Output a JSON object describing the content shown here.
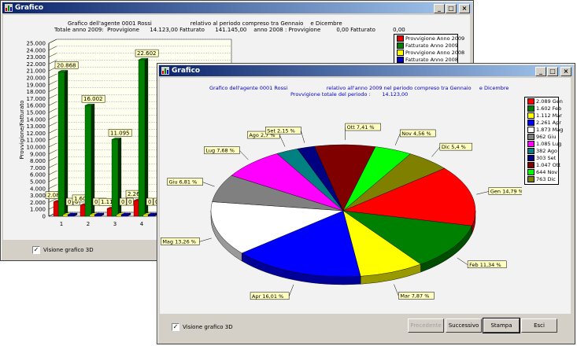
{
  "back": {
    "title": "Grafico",
    "header_line1": "Grafico dell'agente 0001 Rossi                      relativo al periodo compreso tra Gennaio    e Dicembre",
    "header_line2": "Totale anno 2009:  Provvigione      14.123,00 Fatturato      141.145,00    anno 2008 : Provvigione         0,00 Fatturato          0,00",
    "ylabel": "Provvigione/Fatturato",
    "legend": [
      {
        "label": "Provvigione Anno 2009",
        "color": "#e00000"
      },
      {
        "label": "Fatturato Anno 2009",
        "color": "#008000"
      },
      {
        "label": "Provvigione Anno 2008",
        "color": "#ffff00"
      },
      {
        "label": "Fatturato Anno 2008",
        "color": "#0000c0"
      }
    ],
    "checkbox_label": "Visione grafico 3D",
    "checkbox_mark": "✓"
  },
  "front": {
    "title": "Grafico",
    "header_line1": "Grafico dell'agente 0001 Rossi                        relativo all'anno 2009 nel periodo compreso tra Gennaio     e Dicembre",
    "header_line2": "Provvigione totale del periodo :       14.123,00",
    "legend": [
      {
        "label": "2.089 Gen",
        "color": "#ff0000"
      },
      {
        "label": "1.602 Feb",
        "color": "#008000"
      },
      {
        "label": "1.112 Mar",
        "color": "#ffff00"
      },
      {
        "label": "2.261 Apr",
        "color": "#0000ff"
      },
      {
        "label": "1.873 Mag",
        "color": "#ffffff"
      },
      {
        "label": "962 Giu",
        "color": "#808080"
      },
      {
        "label": "1.085 Lug",
        "color": "#ff00ff"
      },
      {
        "label": "382 Ago",
        "color": "#008080"
      },
      {
        "label": "303 Set",
        "color": "#000080"
      },
      {
        "label": "1.047 Ott",
        "color": "#800000"
      },
      {
        "label": "644 Nov",
        "color": "#00ff00"
      },
      {
        "label": "763 Dic",
        "color": "#808000"
      }
    ],
    "checkbox_label": "Visione grafico 3D",
    "checkbox_mark": "✓",
    "buttons": {
      "prev": "Precedente",
      "next": "Successivo",
      "print": "Stampa",
      "exit": "Esci"
    }
  },
  "window_buttons": {
    "minimize": "_",
    "maximize": "□",
    "close": "×"
  },
  "chart_data": [
    {
      "type": "bar",
      "title": "Grafico dell'agente 0001 Rossi relativo al periodo compreso tra Gennaio e Dicembre",
      "ylabel": "Provvigione/Fatturato",
      "ylim": [
        0,
        25000
      ],
      "yticks": [
        "0",
        "1.000",
        "2.000",
        "3.000",
        "4.000",
        "5.000",
        "6.000",
        "7.000",
        "8.000",
        "9.000",
        "10.000",
        "11.000",
        "12.000",
        "13.000",
        "14.000",
        "15.000",
        "16.000",
        "17.000",
        "18.000",
        "19.000",
        "20.000",
        "21.000",
        "22.000",
        "23.000",
        "24.000",
        "25.000"
      ],
      "categories": [
        "1",
        "2",
        "3",
        "4"
      ],
      "series": [
        {
          "name": "Provvigione Anno 2009",
          "color": "#e00000",
          "values": [
            2089,
            1602,
            1112,
            2261
          ],
          "labels": [
            "2.089",
            "1.602",
            "1.112",
            "2.261"
          ]
        },
        {
          "name": "Fatturato Anno 2009",
          "color": "#008000",
          "values": [
            20868,
            16002,
            11095,
            22602
          ],
          "labels": [
            "20.868",
            "16.002",
            "11.095",
            "22.602"
          ]
        },
        {
          "name": "Provvigione Anno 2008",
          "color": "#ffff00",
          "values": [
            0,
            0,
            0,
            0
          ],
          "labels": [
            "0",
            "0",
            "0",
            "0"
          ]
        },
        {
          "name": "Fatturato Anno 2008",
          "color": "#0000c0",
          "values": [
            0,
            0,
            0,
            0
          ],
          "labels": [
            "0",
            "0",
            "0",
            "0"
          ]
        }
      ],
      "grid": true,
      "legend_position": "top-right"
    },
    {
      "type": "pie",
      "title": "Grafico dell'agente 0001 Rossi relativo all'anno 2009 nel periodo compreso tra Gennaio e Dicembre",
      "slices": [
        {
          "month": "Gen",
          "value": 2089,
          "percent": "14,79 %",
          "color": "#ff0000"
        },
        {
          "month": "Feb",
          "value": 1602,
          "percent": "11,34 %",
          "color": "#008000"
        },
        {
          "month": "Mar",
          "value": 1112,
          "percent": "7,87 %",
          "color": "#ffff00"
        },
        {
          "month": "Apr",
          "value": 2261,
          "percent": "16,01 %",
          "color": "#0000ff"
        },
        {
          "month": "Mag",
          "value": 1873,
          "percent": "13,26 %",
          "color": "#ffffff"
        },
        {
          "month": "Giu",
          "value": 962,
          "percent": "6,81 %",
          "color": "#808080"
        },
        {
          "month": "Lug",
          "value": 1085,
          "percent": "7,68 %",
          "color": "#ff00ff"
        },
        {
          "month": "Ago",
          "value": 382,
          "percent": "2,7 %",
          "color": "#008080"
        },
        {
          "month": "Set",
          "value": 303,
          "percent": "2,15 %",
          "color": "#000080"
        },
        {
          "month": "Ott",
          "value": 1047,
          "percent": "7,41 %",
          "color": "#800000"
        },
        {
          "month": "Nov",
          "value": 644,
          "percent": "4,56 %",
          "color": "#00ff00"
        },
        {
          "month": "Dic",
          "value": 763,
          "percent": "5,4 %",
          "color": "#808000"
        }
      ],
      "legend_position": "right",
      "three_d": true
    }
  ]
}
